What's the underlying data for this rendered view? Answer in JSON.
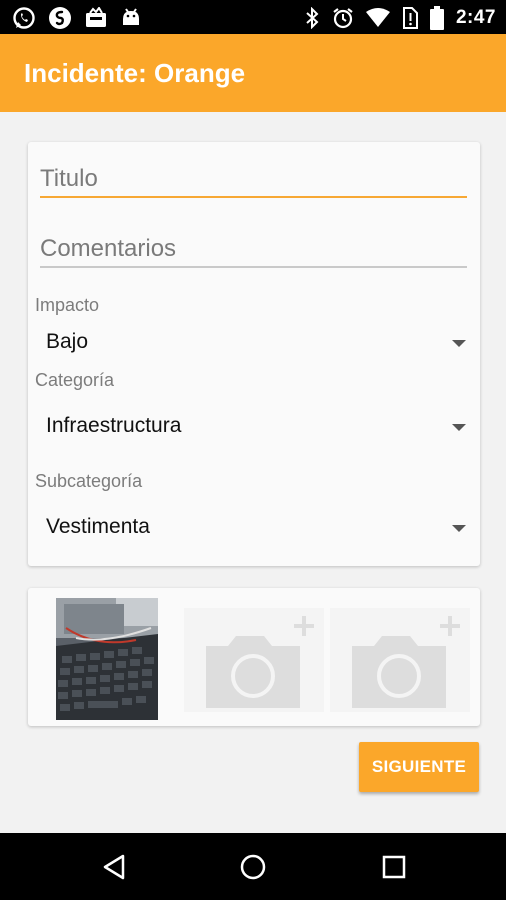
{
  "status_bar": {
    "time": "2:47",
    "icons": [
      "whatsapp-icon",
      "shazam-icon",
      "inbox-icon",
      "android-icon",
      "bluetooth-icon",
      "alarm-icon",
      "wifi-icon",
      "no-sim-icon",
      "battery-icon"
    ]
  },
  "app_bar": {
    "title": "Incidente: Orange"
  },
  "form": {
    "title_placeholder": "Titulo",
    "comments_placeholder": "Comentarios",
    "impacto": {
      "label": "Impacto",
      "value": "Bajo"
    },
    "categoria": {
      "label": "Categoría",
      "value": "Infraestructura"
    },
    "subcategoria": {
      "label": "Subcategoría",
      "value": "Vestimenta"
    }
  },
  "photos": {
    "slots": [
      "photo-thumbnail",
      "add-photo-icon",
      "add-photo-icon"
    ]
  },
  "actions": {
    "next_label": "SIGUIENTE"
  },
  "colors": {
    "accent": "#fba72a",
    "focus_underline": "#f7a834"
  },
  "nav_bar": {
    "icons": [
      "back-icon",
      "home-icon",
      "recents-icon"
    ]
  }
}
